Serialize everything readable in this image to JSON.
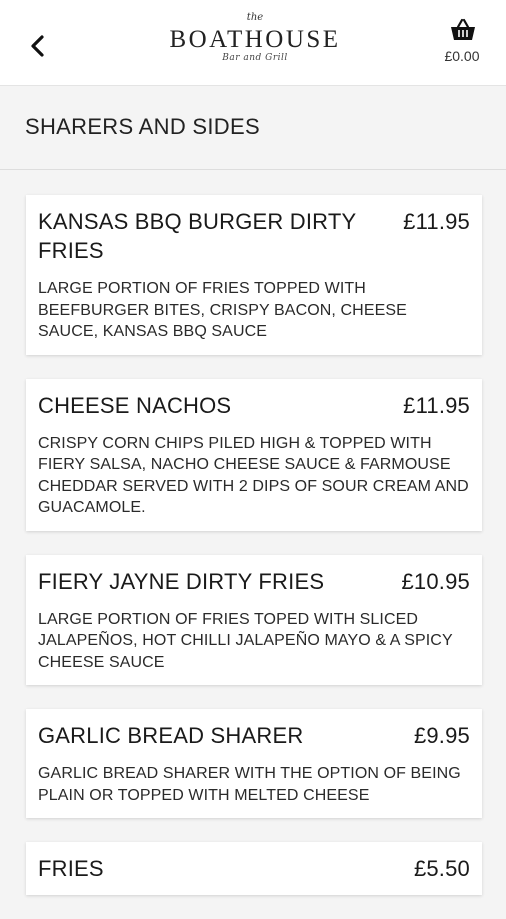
{
  "header": {
    "back_icon": "chevron-left-icon",
    "logo": {
      "the": "the",
      "name": "BOATHOUSE",
      "subtitle": "Bar and Grill"
    },
    "basket": {
      "icon": "basket-icon",
      "total": "£0.00"
    }
  },
  "section": {
    "title": "SHARERS AND SIDES"
  },
  "items": [
    {
      "name": "KANSAS BBQ BURGER DIRTY FRIES",
      "price": "£11.95",
      "description": "LARGE PORTION OF FRIES TOPPED WITH BEEFBURGER BITES, CRISPY BACON, CHEESE SAUCE, KANSAS BBQ SAUCE"
    },
    {
      "name": "CHEESE NACHOS",
      "price": "£11.95",
      "description": "CRISPY CORN CHIPS PILED HIGH & TOPPED WITH FIERY SALSA, NACHO CHEESE SAUCE & FARMOUSE CHEDDAR SERVED WITH 2 DIPS OF SOUR CREAM AND GUACAMOLE."
    },
    {
      "name": "FIERY JAYNE DIRTY FRIES",
      "price": "£10.95",
      "description": "LARGE PORTION OF FRIES TOPED WITH SLICED JALAPEÑOS, HOT CHILLI JALAPEÑO MAYO & A SPICY CHEESE SAUCE"
    },
    {
      "name": "GARLIC BREAD SHARER",
      "price": "£9.95",
      "description": "GARLIC BREAD SHARER WITH THE OPTION OF BEING PLAIN OR TOPPED WITH MELTED CHEESE"
    },
    {
      "name": "FRIES",
      "price": "£5.50",
      "description": ""
    }
  ],
  "colors": {
    "background": "#f4f4f4",
    "card": "#ffffff",
    "text": "#1a1a1a"
  }
}
